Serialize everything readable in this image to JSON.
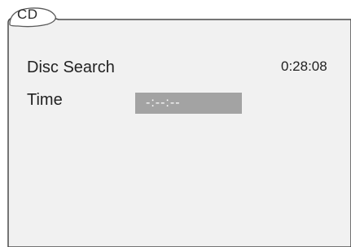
{
  "tab": {
    "label": "CD"
  },
  "disc_search": {
    "label": "Disc Search",
    "elapsed": "0:28:08"
  },
  "time": {
    "label": "Time",
    "value": "-:--:--"
  },
  "colors": {
    "panel_background": "#f1f1f1",
    "border": "#4a4a4a",
    "input_background": "#a3a3a3",
    "input_text": "#ffffff"
  }
}
